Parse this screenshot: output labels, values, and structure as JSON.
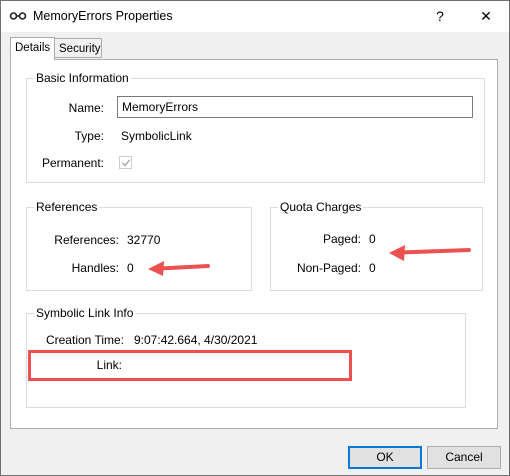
{
  "window": {
    "title": "MemoryErrors Properties",
    "help": "?",
    "close": "✕"
  },
  "tabs": [
    {
      "label": "Details"
    },
    {
      "label": "Security"
    }
  ],
  "basic_info": {
    "title": "Basic Information",
    "name_label": "Name:",
    "name_value": "MemoryErrors",
    "type_label": "Type:",
    "type_value": "SymbolicLink",
    "permanent_label": "Permanent:"
  },
  "references": {
    "title": "References",
    "references_label": "References:",
    "references_value": "32770",
    "handles_label": "Handles:",
    "handles_value": "0"
  },
  "quota": {
    "title": "Quota Charges",
    "paged_label": "Paged:",
    "paged_value": "0",
    "nonpaged_label": "Non-Paged:",
    "nonpaged_value": "0"
  },
  "symlink": {
    "title": "Symbolic Link Info",
    "creation_label": "Creation Time:",
    "creation_value": "9:07:42.664, 4/30/2021",
    "link_label": "Link:"
  },
  "buttons": {
    "ok": "OK",
    "cancel": "Cancel"
  },
  "colors": {
    "annotation": "#ec5050",
    "accent": "#0078d7"
  }
}
